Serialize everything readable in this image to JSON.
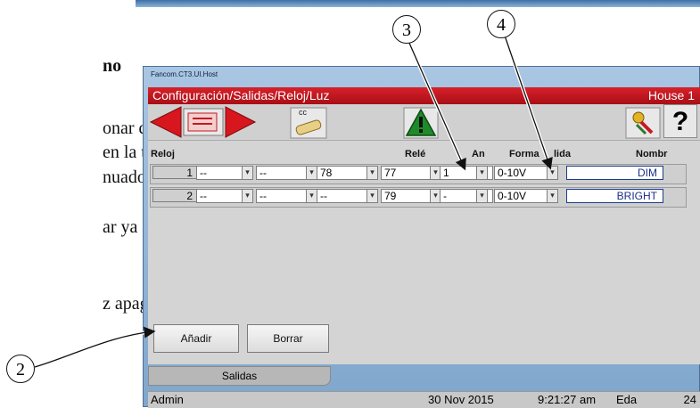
{
  "document": {
    "frag_heading": "no",
    "frag_1": "onar del",
    "frag_2": "en la tarjeta",
    "frag_3": "nuador.",
    "frag_4": "ar ya sea",
    "frag_5": "z apagada)"
  },
  "callouts": {
    "c2": "2",
    "c3": "3",
    "c4": "4"
  },
  "window": {
    "title": "Fancom.CT3.UI.Host",
    "breadcrumb": "Configuración/Salidas/Reloj/Luz",
    "house": "House 1"
  },
  "toolbar": {
    "cc_label": "cc",
    "help_label": "?",
    "icons": [
      "arrow-left-icon",
      "list-icon",
      "arrow-right-icon",
      "cc-scroll-icon",
      "warning-icon",
      "keys-icon",
      "help-icon"
    ]
  },
  "table": {
    "headers": {
      "reloj": "Reloj",
      "rele": "Relé",
      "an": "An",
      "forma": "Forma",
      "salida": "lida",
      "nombre": "Nombr"
    },
    "rows": [
      {
        "num": "1",
        "c1": "--",
        "c2": "--",
        "c3": "78",
        "c4": "77",
        "c5": "1",
        "forma": "0-10V",
        "name": "DIM"
      },
      {
        "num": "2",
        "c1": "--",
        "c2": "--",
        "c3": "--",
        "c4": "79",
        "c5": "-",
        "forma": "0-10V",
        "name": "BRIGHT"
      }
    ],
    "dropdown_glyph": "▾"
  },
  "buttons": {
    "add": "Añadir",
    "delete": "Borrar"
  },
  "tab": {
    "label": "Salidas"
  },
  "status": {
    "user": "Admin",
    "date": "30 Nov 2015",
    "time": "9:21:27 am",
    "mode": "Eda",
    "day": "24"
  },
  "colors": {
    "accent_red": "#c8141c",
    "name_blue": "#1c2f88"
  }
}
